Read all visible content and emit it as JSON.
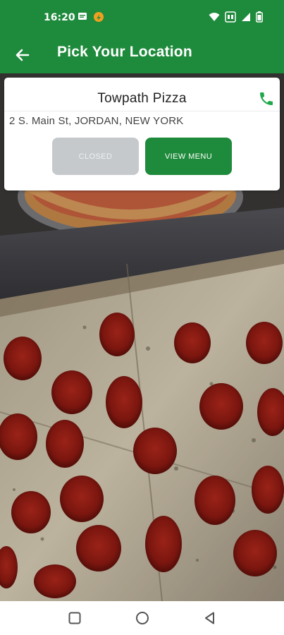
{
  "status_bar": {
    "time": "16:20",
    "left_icons": [
      "message-icon",
      "app-notification-icon"
    ],
    "right_icons": [
      "wifi-icon",
      "data-icon",
      "signal-icon",
      "battery-icon"
    ]
  },
  "app_bar": {
    "title": "Pick Your Location",
    "back_icon": "arrow-left-icon",
    "color": "#1e8a3b"
  },
  "location": {
    "name": "Towpath Pizza",
    "address": "2 S. Main St, JORDAN, NEW YORK",
    "phone_icon": "phone-icon",
    "closed_label": "CLOSED",
    "menu_label": "VIEW MENU"
  },
  "nav_bar": {
    "buttons": [
      "recents-square-icon",
      "home-circle-icon",
      "back-triangle-icon"
    ]
  }
}
